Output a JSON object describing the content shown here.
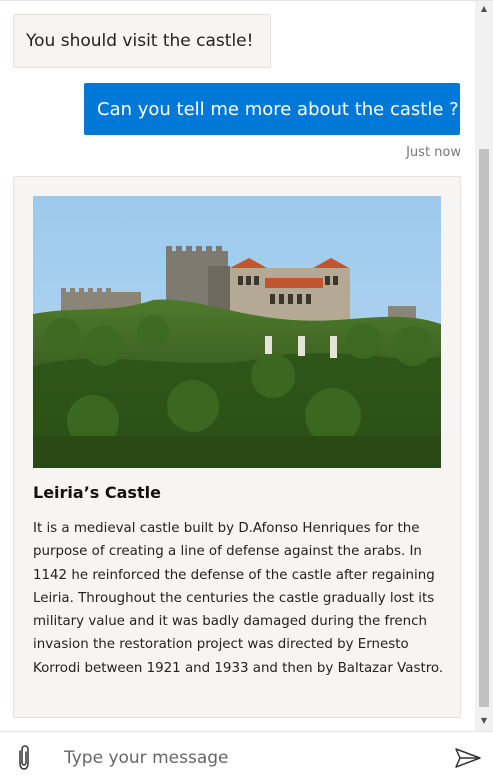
{
  "messages": [
    {
      "from": "bot",
      "text": "You should visit the castle!"
    },
    {
      "from": "user",
      "text": "Can you tell me more about the castle ?",
      "timestamp": "Just now"
    }
  ],
  "card": {
    "image_icon": "castle-photo",
    "title": "Leiria’s Castle",
    "text": "It is a medieval castle built by D.Afonso Henriques for the purpose of creating a line of defense against the arabs. In 1142 he reinforced the defense of the castle after regaining Leiria. Throughout the centuries the castle gradually lost its military value and it was badly damaged during the french invasion the restoration project was directed by Ernesto Korrodi between 1921 and 1933 and then by Baltazar Vastro."
  },
  "composer": {
    "placeholder": "Type your message",
    "attach_icon": "paperclip-icon",
    "send_icon": "send-icon"
  },
  "colors": {
    "accent": "#0078d7",
    "bubble_bg": "#f7f5f3"
  }
}
